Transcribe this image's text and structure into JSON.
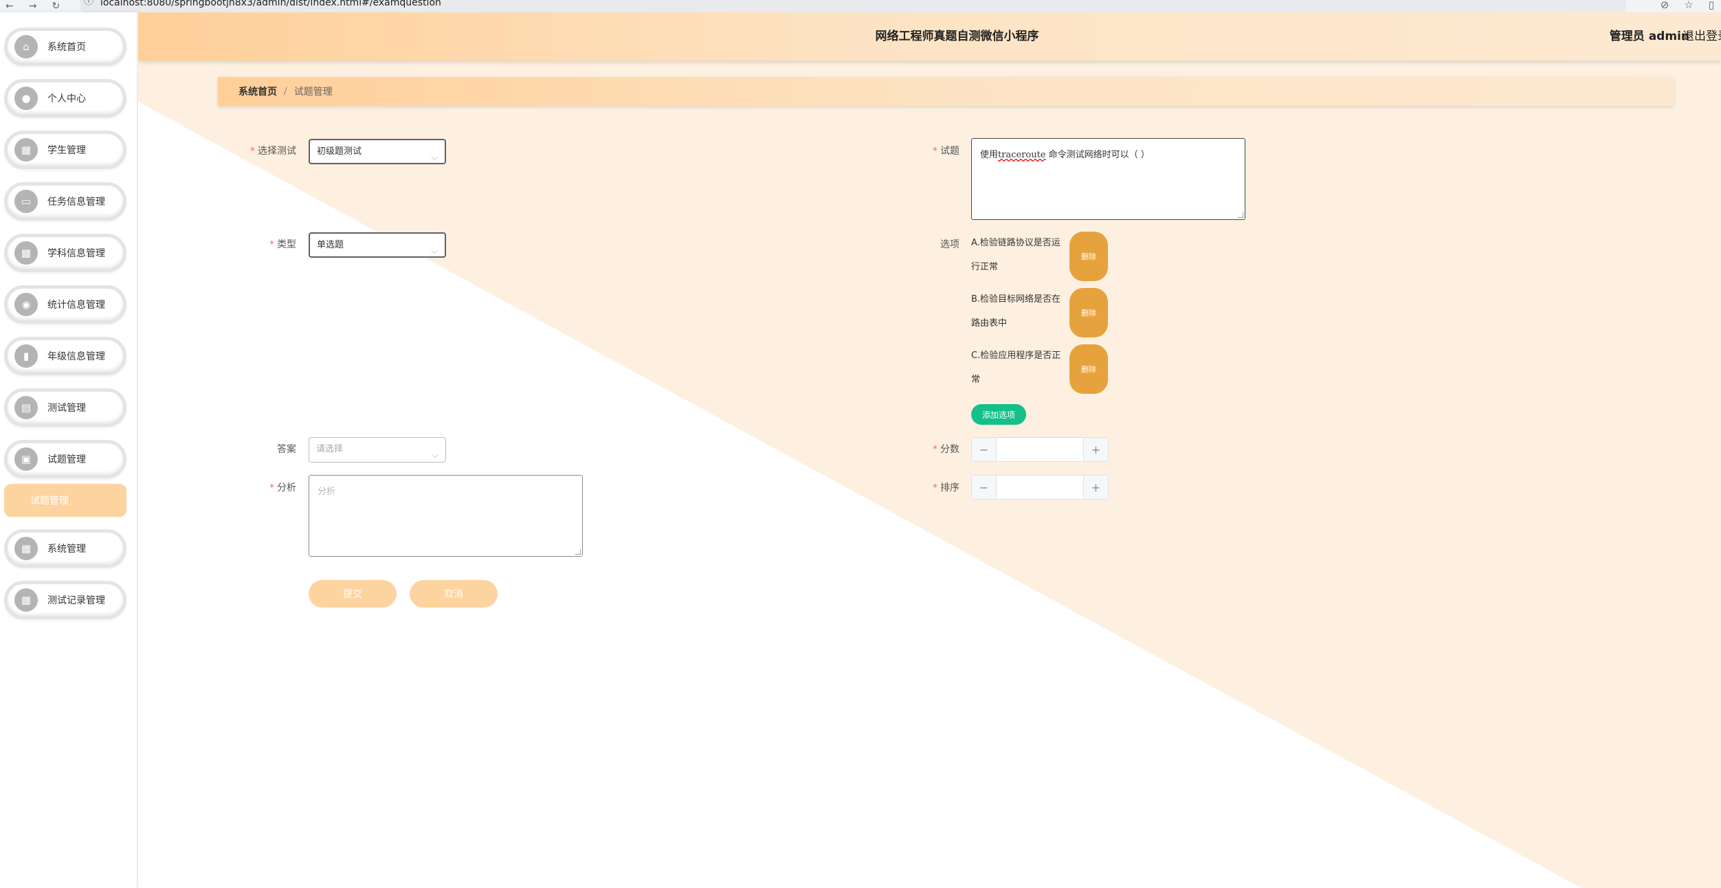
{
  "browser": {
    "url": "localhost:8080/springbootjn8x3/admin/dist/index.html#/examquestion",
    "nav_icons": [
      "←",
      "→",
      "↻"
    ],
    "right_icons": [
      "⊘",
      "☆",
      "▯"
    ]
  },
  "header": {
    "title": "网络工程师真题自测微信小程序",
    "user": "管理员 admin",
    "logout": "退出登录"
  },
  "sidebar": {
    "items": [
      {
        "label": "系统首页",
        "icon": "home-icon",
        "glyph": "⌂"
      },
      {
        "label": "个人中心",
        "icon": "user-icon",
        "glyph": "●"
      },
      {
        "label": "学生管理",
        "icon": "grid-icon",
        "glyph": "▦"
      },
      {
        "label": "任务信息管理",
        "icon": "monitor-icon",
        "glyph": "▭"
      },
      {
        "label": "学科信息管理",
        "icon": "grid-icon",
        "glyph": "▦"
      },
      {
        "label": "统计信息管理",
        "icon": "location-icon",
        "glyph": "◉"
      },
      {
        "label": "年级信息管理",
        "icon": "bar-chart-icon",
        "glyph": "▮"
      },
      {
        "label": "测试管理",
        "icon": "document-icon",
        "glyph": "▤"
      },
      {
        "label": "试题管理",
        "icon": "clipboard-icon",
        "glyph": "▣"
      },
      {
        "label": "系统管理",
        "icon": "grid-icon",
        "glyph": "▦"
      },
      {
        "label": "测试记录管理",
        "icon": "grid-icon",
        "glyph": "▦"
      }
    ],
    "sub_item": "试题管理"
  },
  "breadcrumb": {
    "home": "系统首页",
    "separator": "/",
    "current": "试题管理"
  },
  "form": {
    "exam": {
      "label": "选择测试",
      "value": "初级题测试"
    },
    "type": {
      "label": "类型",
      "value": "单选题"
    },
    "answer": {
      "label": "答案",
      "placeholder": "请选择"
    },
    "analysis": {
      "label": "分析",
      "placeholder": "分析"
    },
    "question": {
      "label": "试题",
      "value_prefix": "使用",
      "value_code": "traceroute",
      "value_suffix": " 命令测试网络时可以（ ）"
    },
    "options": {
      "label": "选项",
      "items": [
        {
          "line1": "A.检验链路协议是否运",
          "line2": "行正常",
          "delete": "删除"
        },
        {
          "line1": "B.检验目标网络是否在",
          "line2": "路由表中",
          "delete": "删除"
        },
        {
          "line1": "C.检验应用程序是否正",
          "line2": "常",
          "delete": "删除"
        }
      ],
      "add_label": "添加选项"
    },
    "score": {
      "label": "分数",
      "minus": "−",
      "plus": "+"
    },
    "order": {
      "label": "排序",
      "minus": "−",
      "plus": "+"
    },
    "submit": "提交",
    "cancel": "取消"
  },
  "colors": {
    "accent": "#fdd3a0",
    "header_start": "#ffcf98",
    "background_tint": "#fdf0e0",
    "delete": "#e6a23c",
    "add": "#14c08a",
    "required": "#f56c6c"
  }
}
